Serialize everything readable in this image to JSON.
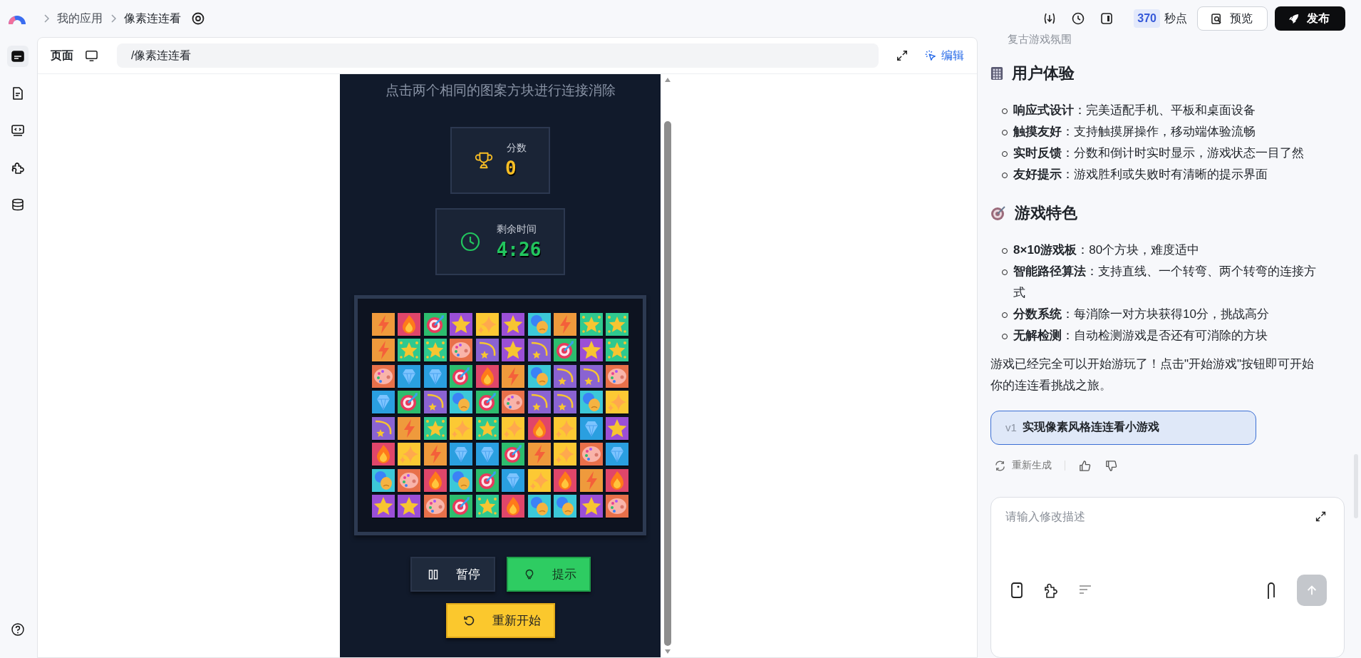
{
  "topbar": {
    "breadcrumbs": [
      {
        "label": "我的应用"
      },
      {
        "label": "像素连连看"
      }
    ],
    "points": {
      "value": "370",
      "unit": "秒点"
    },
    "preview_button": "预览",
    "publish_button": "发布"
  },
  "sidebar": {
    "items": [
      {
        "kind": "layout",
        "selected": true
      },
      {
        "kind": "document",
        "selected": false
      },
      {
        "kind": "code",
        "selected": false
      },
      {
        "kind": "plugin",
        "selected": false
      },
      {
        "kind": "database",
        "selected": false
      }
    ]
  },
  "preview": {
    "tab": "页面",
    "url": "/像素连连看",
    "edit_button": "编辑"
  },
  "game": {
    "instruction": "点击两个相同的图案方块进行连接消除",
    "score": {
      "label": "分数",
      "value": "0"
    },
    "timer": {
      "label": "剩余时间",
      "value": "4:26"
    },
    "board": [
      [
        {
          "kind": "lightning"
        },
        {
          "kind": "fire"
        },
        {
          "kind": "target"
        },
        {
          "kind": "star"
        },
        {
          "kind": "sparkle"
        },
        {
          "kind": "star"
        },
        {
          "kind": "masks"
        },
        {
          "kind": "lightning"
        },
        {
          "kind": "glitter"
        },
        {
          "kind": "glitter"
        }
      ],
      [
        {
          "kind": "lightning"
        },
        {
          "kind": "glitter"
        },
        {
          "kind": "glitter"
        },
        {
          "kind": "palette"
        },
        {
          "kind": "comet"
        },
        {
          "kind": "star"
        },
        {
          "kind": "comet"
        },
        {
          "kind": "target"
        },
        {
          "kind": "star"
        },
        {
          "kind": "glitter"
        }
      ],
      [
        {
          "kind": "palette"
        },
        {
          "kind": "diamond"
        },
        {
          "kind": "diamond"
        },
        {
          "kind": "target"
        },
        {
          "kind": "fire"
        },
        {
          "kind": "lightning"
        },
        {
          "kind": "masks"
        },
        {
          "kind": "comet"
        },
        {
          "kind": "comet"
        },
        {
          "kind": "palette"
        }
      ],
      [
        {
          "kind": "diamond"
        },
        {
          "kind": "target"
        },
        {
          "kind": "comet"
        },
        {
          "kind": "masks"
        },
        {
          "kind": "target"
        },
        {
          "kind": "palette"
        },
        {
          "kind": "comet"
        },
        {
          "kind": "comet"
        },
        {
          "kind": "masks"
        },
        {
          "kind": "sparkle"
        }
      ],
      [
        {
          "kind": "comet"
        },
        {
          "kind": "lightning"
        },
        {
          "kind": "glitter"
        },
        {
          "kind": "sparkle"
        },
        {
          "kind": "glitter"
        },
        {
          "kind": "sparkle"
        },
        {
          "kind": "fire"
        },
        {
          "kind": "sparkle"
        },
        {
          "kind": "diamond"
        },
        {
          "kind": "star"
        }
      ],
      [
        {
          "kind": "fire"
        },
        {
          "kind": "sparkle"
        },
        {
          "kind": "lightning"
        },
        {
          "kind": "diamond"
        },
        {
          "kind": "diamond"
        },
        {
          "kind": "target"
        },
        {
          "kind": "lightning"
        },
        {
          "kind": "sparkle"
        },
        {
          "kind": "palette"
        },
        {
          "kind": "diamond"
        }
      ],
      [
        {
          "kind": "masks"
        },
        {
          "kind": "palette"
        },
        {
          "kind": "fire"
        },
        {
          "kind": "masks"
        },
        {
          "kind": "target"
        },
        {
          "kind": "diamond"
        },
        {
          "kind": "sparkle"
        },
        {
          "kind": "fire"
        },
        {
          "kind": "lightning"
        },
        {
          "kind": "fire"
        }
      ],
      [
        {
          "kind": "star"
        },
        {
          "kind": "star"
        },
        {
          "kind": "palette"
        },
        {
          "kind": "target"
        },
        {
          "kind": "glitter"
        },
        {
          "kind": "fire"
        },
        {
          "kind": "masks"
        },
        {
          "kind": "masks"
        },
        {
          "kind": "star"
        },
        {
          "kind": "palette"
        }
      ]
    ],
    "buttons": [
      {
        "kind": "pause",
        "label": "暂停"
      },
      {
        "kind": "hint",
        "label": "提示"
      },
      {
        "kind": "restart",
        "label": "重新开始"
      }
    ]
  },
  "chat": {
    "faded_heading": "复古游戏氛围",
    "sections": [
      {
        "kind": "calculator",
        "title": "用户体验",
        "items": [
          "**响应式设计**：完美适配手机、平板和桌面设备",
          "**触摸友好**：支持触摸屏操作，移动端体验流畅",
          "**实时反馈**：分数和倒计时实时显示，游戏状态一目了然",
          "**友好提示**：游戏胜利或失败时有清晰的提示界面"
        ]
      },
      {
        "kind": "target",
        "title": "游戏特色",
        "items": [
          "**8×10游戏板**：80个方块，难度适中",
          "**智能路径算法**：支持直线、一个转弯、两个转弯的连接方式",
          "**分数系统**：每消除一对方块获得10分，挑战高分",
          "**无解检测**：自动检测游戏是否还有可消除的方块"
        ]
      }
    ],
    "summary": "游戏已经完全可以开始游玩了！点击\"开始游戏\"按钮即可开始你的连连看挑战之旅。",
    "version": {
      "tag": "v1",
      "title": "实现像素风格连连看小游戏"
    },
    "regenerate": "重新生成",
    "input": {
      "placeholder": "请输入修改描述"
    }
  }
}
